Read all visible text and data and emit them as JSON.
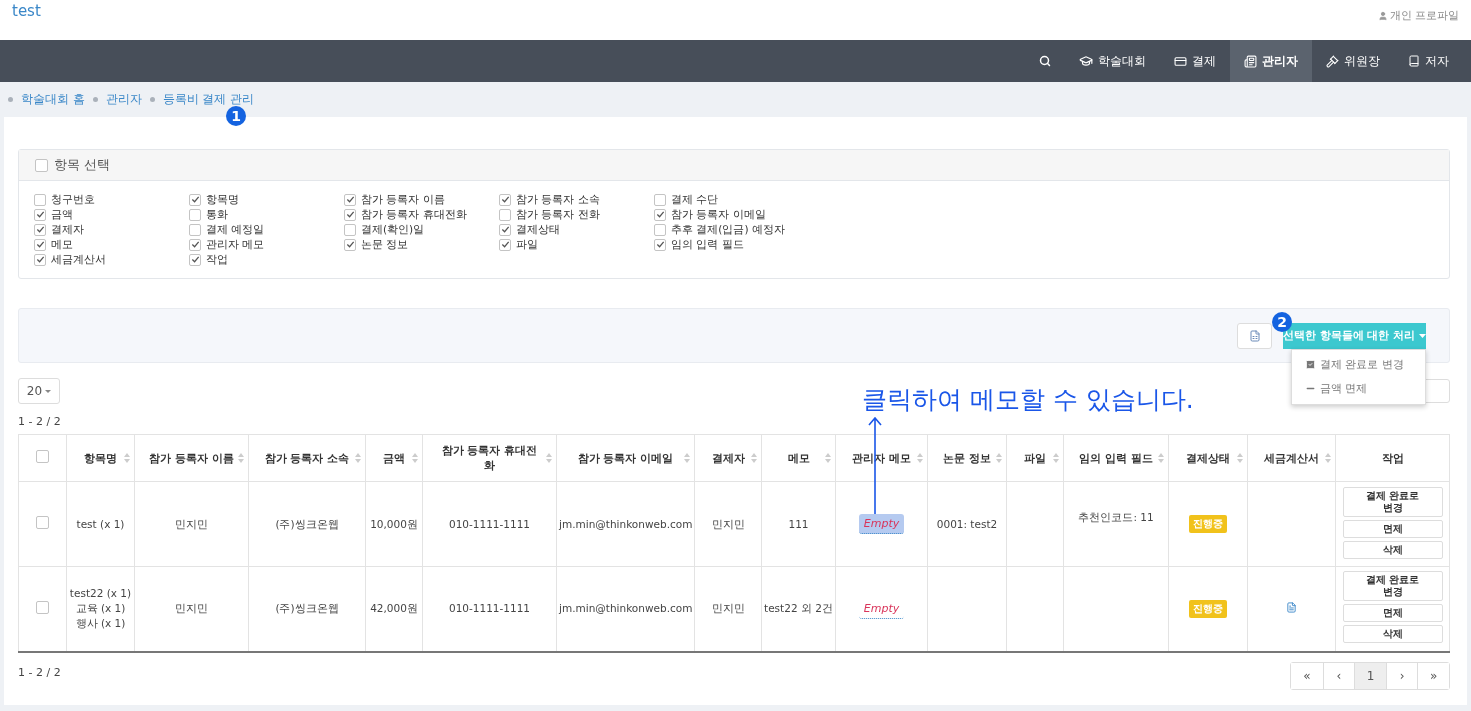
{
  "site_title": "test",
  "profile_link": "개인 프로파일",
  "nav": [
    {
      "kind": "search",
      "selected": false
    },
    {
      "kind": "cap",
      "label": "학술대회",
      "selected": false
    },
    {
      "kind": "card",
      "label": "결제",
      "selected": false
    },
    {
      "kind": "admin",
      "label": "관리자",
      "selected": true
    },
    {
      "kind": "gavel",
      "label": "위원장",
      "selected": false
    },
    {
      "kind": "book",
      "label": "저자",
      "selected": false
    }
  ],
  "breadcrumb": [
    "학술대회 홈",
    "관리자",
    "등록비 결제 관리"
  ],
  "column_picker": {
    "title": "항목 선택",
    "checked": false,
    "options": [
      {
        "label": "청구번호",
        "checked": false
      },
      {
        "label": "항목명",
        "checked": true
      },
      {
        "label": "참가 등록자 이름",
        "checked": true
      },
      {
        "label": "참가 등록자 소속",
        "checked": true
      },
      {
        "label": "결제 수단",
        "checked": false
      },
      {
        "label": "금액",
        "checked": true
      },
      {
        "label": "통화",
        "checked": false
      },
      {
        "label": "참가 등록자 휴대전화",
        "checked": true
      },
      {
        "label": "참가 등록자 전화",
        "checked": false
      },
      {
        "label": "참가 등록자 이메일",
        "checked": true
      },
      {
        "label": "결제자",
        "checked": true
      },
      {
        "label": "결제 예정일",
        "checked": false
      },
      {
        "label": "결제(확인)일",
        "checked": false
      },
      {
        "label": "결제상태",
        "checked": true
      },
      {
        "label": "추후 결제(입금) 예정자",
        "checked": false
      },
      {
        "label": "메모",
        "checked": true
      },
      {
        "label": "관리자 메모",
        "checked": true
      },
      {
        "label": "논문 정보",
        "checked": true
      },
      {
        "label": "파일",
        "checked": true
      },
      {
        "label": "임의 입력 필드",
        "checked": true
      },
      {
        "label": "세금계산서",
        "checked": true
      },
      {
        "label": "작업",
        "checked": true
      }
    ]
  },
  "bulk_action": {
    "label": "선택한 항목들에 대한 처리",
    "menu": [
      {
        "kind": "check",
        "label": "결제 완료로 변경"
      },
      {
        "kind": "minus",
        "label": "금액 면제"
      }
    ]
  },
  "page_size": "20",
  "count_top": "1 - 2 / 2",
  "table": {
    "header_checked": false,
    "columns": [
      {
        "label": "항목명",
        "sortable": true
      },
      {
        "label": "참가 등록자 이름",
        "sortable": true
      },
      {
        "label": "참가 등록자 소속",
        "sortable": true
      },
      {
        "label": "금액",
        "sortable": true
      },
      {
        "label": "참가 등록자 휴대전화",
        "sortable": true
      },
      {
        "label": "참가 등록자 이메일",
        "sortable": true
      },
      {
        "label": "결제자",
        "sortable": true
      },
      {
        "label": "메모",
        "sortable": true
      },
      {
        "label": "관리자 메모",
        "sortable": true
      },
      {
        "label": "논문 정보",
        "sortable": true
      },
      {
        "label": "파일",
        "sortable": true
      },
      {
        "label": "임의 입력 필드",
        "sortable": true
      },
      {
        "label": "결제상태",
        "sortable": true
      },
      {
        "label": "세금계산서",
        "sortable": true
      },
      {
        "label": "작업",
        "sortable": false
      }
    ],
    "rows": [
      {
        "checked": false,
        "items": [
          "test (x 1)"
        ],
        "name": "민지민",
        "affiliation": "(주)씽크온웹",
        "amount": "10,000원",
        "phone": "010-1111-1111",
        "email": "jm.min@thinkonweb.com",
        "payer": "민지민",
        "memo": "111",
        "admin_memo": {
          "text": "Empty",
          "highlighted": true
        },
        "paper": "0001: test2",
        "custom_field": "추천인코드: 11",
        "status": "진행중",
        "tax_invoice": false,
        "actions": [
          "결제 완료로 변경",
          "면제",
          "삭제"
        ]
      },
      {
        "checked": false,
        "items": [
          "test22 (x 1)",
          "교육 (x 1)",
          "행사 (x 1)"
        ],
        "name": "민지민",
        "affiliation": "(주)씽크온웹",
        "amount": "42,000원",
        "phone": "010-1111-1111",
        "email": "jm.min@thinkonweb.com",
        "payer": "민지민",
        "memo": "test22 외 2건",
        "admin_memo": {
          "text": "Empty",
          "highlighted": false
        },
        "paper": "",
        "custom_field": "",
        "status": "진행중",
        "tax_invoice": true,
        "actions": [
          "결제 완료로 변경",
          "면제",
          "삭제"
        ]
      }
    ]
  },
  "count_bottom": "1 - 2 / 2",
  "pagination": [
    {
      "label": "«",
      "selected": false
    },
    {
      "label": "‹",
      "selected": false
    },
    {
      "label": "1",
      "selected": true
    },
    {
      "label": "›",
      "selected": false
    },
    {
      "label": "»",
      "selected": false
    }
  ],
  "annotations": {
    "badges": [
      "1",
      "2"
    ],
    "note": "클릭하여 메모할 수 있습니다."
  }
}
